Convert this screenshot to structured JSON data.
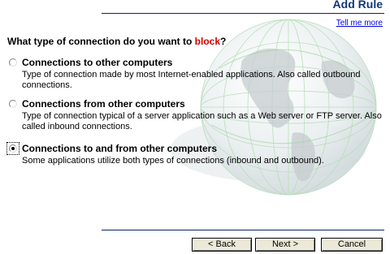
{
  "header": {
    "title": "Add Rule",
    "help_link": "Tell me more"
  },
  "question": {
    "prefix": "What type of connection do you want to ",
    "keyword": "block",
    "suffix": "?"
  },
  "options": [
    {
      "label": "Connections to other computers",
      "description": "Type of connection made by most Internet-enabled applications. Also called outbound connections.",
      "selected": false
    },
    {
      "label": "Connections from other computers",
      "description": "Type of connection typical of a server application such as a Web server or FTP server. Also called inbound connections.",
      "selected": false
    },
    {
      "label": "Connections to and from other computers",
      "description": "Some applications utilize both types of connections (inbound and outbound).",
      "selected": true
    }
  ],
  "buttons": {
    "back": "< Back",
    "next": "Next >",
    "cancel": "Cancel"
  },
  "colors": {
    "accent_red": "#d10000",
    "header_blue": "#10377a",
    "link_blue": "#0000ee",
    "rule_navy": "#0a246a"
  },
  "icons": {
    "background": "globe-icon"
  }
}
